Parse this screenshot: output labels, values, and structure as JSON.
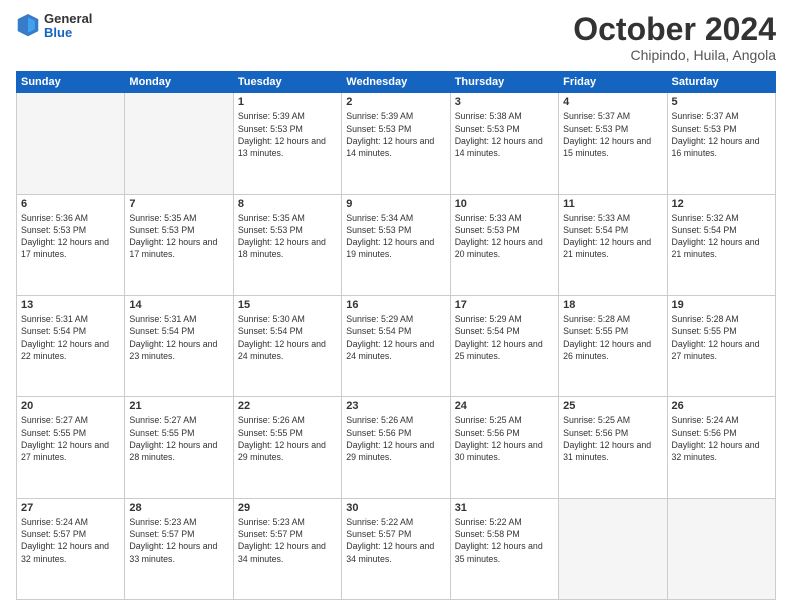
{
  "header": {
    "logo": {
      "general": "General",
      "blue": "Blue"
    },
    "title": "October 2024",
    "location": "Chipindo, Huila, Angola"
  },
  "weekdays": [
    "Sunday",
    "Monday",
    "Tuesday",
    "Wednesday",
    "Thursday",
    "Friday",
    "Saturday"
  ],
  "weeks": [
    [
      {
        "day": "",
        "sunrise": "",
        "sunset": "",
        "daylight": ""
      },
      {
        "day": "",
        "sunrise": "",
        "sunset": "",
        "daylight": ""
      },
      {
        "day": "1",
        "sunrise": "Sunrise: 5:39 AM",
        "sunset": "Sunset: 5:53 PM",
        "daylight": "Daylight: 12 hours and 13 minutes."
      },
      {
        "day": "2",
        "sunrise": "Sunrise: 5:39 AM",
        "sunset": "Sunset: 5:53 PM",
        "daylight": "Daylight: 12 hours and 14 minutes."
      },
      {
        "day": "3",
        "sunrise": "Sunrise: 5:38 AM",
        "sunset": "Sunset: 5:53 PM",
        "daylight": "Daylight: 12 hours and 14 minutes."
      },
      {
        "day": "4",
        "sunrise": "Sunrise: 5:37 AM",
        "sunset": "Sunset: 5:53 PM",
        "daylight": "Daylight: 12 hours and 15 minutes."
      },
      {
        "day": "5",
        "sunrise": "Sunrise: 5:37 AM",
        "sunset": "Sunset: 5:53 PM",
        "daylight": "Daylight: 12 hours and 16 minutes."
      }
    ],
    [
      {
        "day": "6",
        "sunrise": "Sunrise: 5:36 AM",
        "sunset": "Sunset: 5:53 PM",
        "daylight": "Daylight: 12 hours and 17 minutes."
      },
      {
        "day": "7",
        "sunrise": "Sunrise: 5:35 AM",
        "sunset": "Sunset: 5:53 PM",
        "daylight": "Daylight: 12 hours and 17 minutes."
      },
      {
        "day": "8",
        "sunrise": "Sunrise: 5:35 AM",
        "sunset": "Sunset: 5:53 PM",
        "daylight": "Daylight: 12 hours and 18 minutes."
      },
      {
        "day": "9",
        "sunrise": "Sunrise: 5:34 AM",
        "sunset": "Sunset: 5:53 PM",
        "daylight": "Daylight: 12 hours and 19 minutes."
      },
      {
        "day": "10",
        "sunrise": "Sunrise: 5:33 AM",
        "sunset": "Sunset: 5:53 PM",
        "daylight": "Daylight: 12 hours and 20 minutes."
      },
      {
        "day": "11",
        "sunrise": "Sunrise: 5:33 AM",
        "sunset": "Sunset: 5:54 PM",
        "daylight": "Daylight: 12 hours and 21 minutes."
      },
      {
        "day": "12",
        "sunrise": "Sunrise: 5:32 AM",
        "sunset": "Sunset: 5:54 PM",
        "daylight": "Daylight: 12 hours and 21 minutes."
      }
    ],
    [
      {
        "day": "13",
        "sunrise": "Sunrise: 5:31 AM",
        "sunset": "Sunset: 5:54 PM",
        "daylight": "Daylight: 12 hours and 22 minutes."
      },
      {
        "day": "14",
        "sunrise": "Sunrise: 5:31 AM",
        "sunset": "Sunset: 5:54 PM",
        "daylight": "Daylight: 12 hours and 23 minutes."
      },
      {
        "day": "15",
        "sunrise": "Sunrise: 5:30 AM",
        "sunset": "Sunset: 5:54 PM",
        "daylight": "Daylight: 12 hours and 24 minutes."
      },
      {
        "day": "16",
        "sunrise": "Sunrise: 5:29 AM",
        "sunset": "Sunset: 5:54 PM",
        "daylight": "Daylight: 12 hours and 24 minutes."
      },
      {
        "day": "17",
        "sunrise": "Sunrise: 5:29 AM",
        "sunset": "Sunset: 5:54 PM",
        "daylight": "Daylight: 12 hours and 25 minutes."
      },
      {
        "day": "18",
        "sunrise": "Sunrise: 5:28 AM",
        "sunset": "Sunset: 5:55 PM",
        "daylight": "Daylight: 12 hours and 26 minutes."
      },
      {
        "day": "19",
        "sunrise": "Sunrise: 5:28 AM",
        "sunset": "Sunset: 5:55 PM",
        "daylight": "Daylight: 12 hours and 27 minutes."
      }
    ],
    [
      {
        "day": "20",
        "sunrise": "Sunrise: 5:27 AM",
        "sunset": "Sunset: 5:55 PM",
        "daylight": "Daylight: 12 hours and 27 minutes."
      },
      {
        "day": "21",
        "sunrise": "Sunrise: 5:27 AM",
        "sunset": "Sunset: 5:55 PM",
        "daylight": "Daylight: 12 hours and 28 minutes."
      },
      {
        "day": "22",
        "sunrise": "Sunrise: 5:26 AM",
        "sunset": "Sunset: 5:55 PM",
        "daylight": "Daylight: 12 hours and 29 minutes."
      },
      {
        "day": "23",
        "sunrise": "Sunrise: 5:26 AM",
        "sunset": "Sunset: 5:56 PM",
        "daylight": "Daylight: 12 hours and 29 minutes."
      },
      {
        "day": "24",
        "sunrise": "Sunrise: 5:25 AM",
        "sunset": "Sunset: 5:56 PM",
        "daylight": "Daylight: 12 hours and 30 minutes."
      },
      {
        "day": "25",
        "sunrise": "Sunrise: 5:25 AM",
        "sunset": "Sunset: 5:56 PM",
        "daylight": "Daylight: 12 hours and 31 minutes."
      },
      {
        "day": "26",
        "sunrise": "Sunrise: 5:24 AM",
        "sunset": "Sunset: 5:56 PM",
        "daylight": "Daylight: 12 hours and 32 minutes."
      }
    ],
    [
      {
        "day": "27",
        "sunrise": "Sunrise: 5:24 AM",
        "sunset": "Sunset: 5:57 PM",
        "daylight": "Daylight: 12 hours and 32 minutes."
      },
      {
        "day": "28",
        "sunrise": "Sunrise: 5:23 AM",
        "sunset": "Sunset: 5:57 PM",
        "daylight": "Daylight: 12 hours and 33 minutes."
      },
      {
        "day": "29",
        "sunrise": "Sunrise: 5:23 AM",
        "sunset": "Sunset: 5:57 PM",
        "daylight": "Daylight: 12 hours and 34 minutes."
      },
      {
        "day": "30",
        "sunrise": "Sunrise: 5:22 AM",
        "sunset": "Sunset: 5:57 PM",
        "daylight": "Daylight: 12 hours and 34 minutes."
      },
      {
        "day": "31",
        "sunrise": "Sunrise: 5:22 AM",
        "sunset": "Sunset: 5:58 PM",
        "daylight": "Daylight: 12 hours and 35 minutes."
      },
      {
        "day": "",
        "sunrise": "",
        "sunset": "",
        "daylight": ""
      },
      {
        "day": "",
        "sunrise": "",
        "sunset": "",
        "daylight": ""
      }
    ]
  ]
}
